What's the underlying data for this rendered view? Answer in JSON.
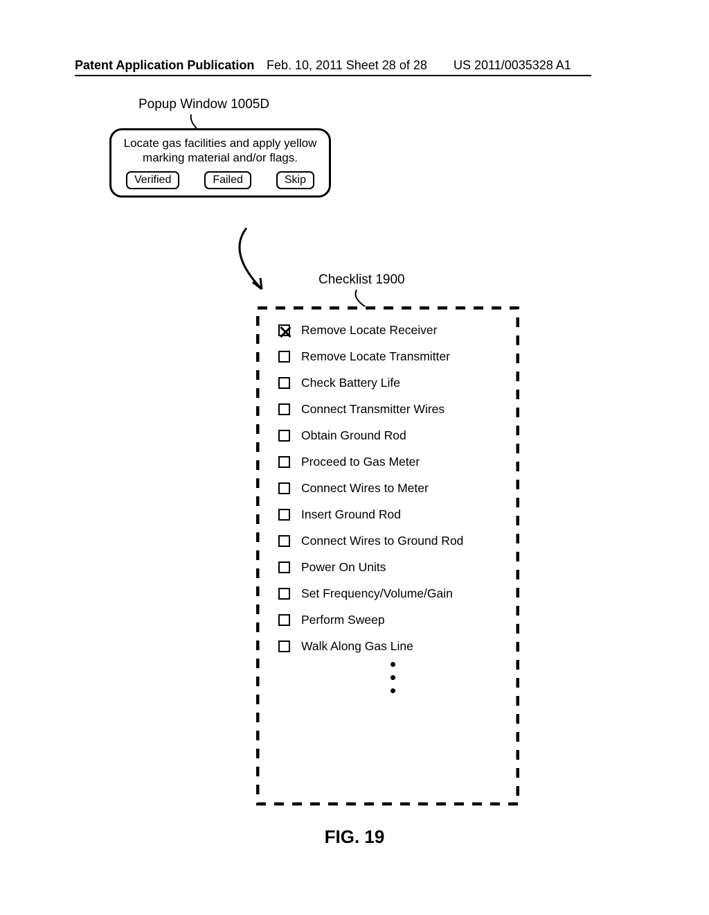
{
  "header": {
    "left": "Patent Application Publication",
    "mid": "Feb. 10, 2011   Sheet 28 of 28",
    "right": "US 2011/0035328 A1"
  },
  "popup": {
    "label": "Popup Window 1005D",
    "text": "Locate gas facilities and apply yellow marking material and/or flags.",
    "buttons": {
      "verified": "Verified",
      "failed": "Failed",
      "skip": "Skip"
    }
  },
  "checklist": {
    "label": "Checklist 1900",
    "items": [
      {
        "checked": true,
        "text": "Remove Locate Receiver"
      },
      {
        "checked": false,
        "text": "Remove Locate Transmitter"
      },
      {
        "checked": false,
        "text": "Check Battery Life"
      },
      {
        "checked": false,
        "text": "Connect Transmitter Wires"
      },
      {
        "checked": false,
        "text": "Obtain Ground Rod"
      },
      {
        "checked": false,
        "text": "Proceed to Gas Meter"
      },
      {
        "checked": false,
        "text": "Connect Wires to Meter"
      },
      {
        "checked": false,
        "text": "Insert Ground Rod"
      },
      {
        "checked": false,
        "text": "Connect Wires to Ground Rod"
      },
      {
        "checked": false,
        "text": "Power On Units"
      },
      {
        "checked": false,
        "text": "Set Frequency/Volume/Gain"
      },
      {
        "checked": false,
        "text": "Perform Sweep"
      },
      {
        "checked": false,
        "text": "Walk Along Gas Line"
      }
    ]
  },
  "figure_label": "FIG. 19"
}
